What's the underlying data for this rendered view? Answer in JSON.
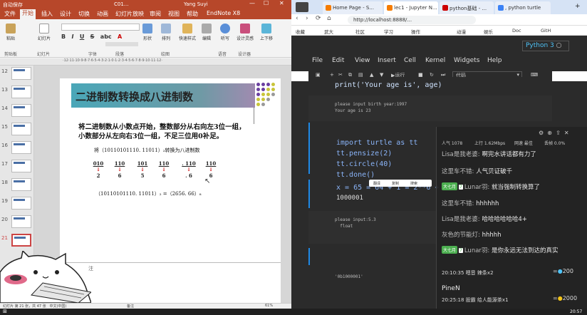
{
  "ppt": {
    "title_bar": {
      "quick": "自动保存",
      "doc": "C01...",
      "user": "Yang Suyi"
    },
    "tabs": [
      "文件",
      "开始",
      "插入",
      "设计",
      "切换",
      "动画",
      "幻灯片放映",
      "审阅",
      "视图",
      "帮助",
      "EndNote X8"
    ],
    "active_tab": "开始",
    "ribbon": {
      "buttons": [
        {
          "label": "粘贴"
        },
        {
          "label": "幻灯片"
        },
        {
          "label": "形状"
        },
        {
          "label": "排列"
        },
        {
          "label": "快速样式"
        },
        {
          "label": "编辑"
        },
        {
          "label": "听写"
        },
        {
          "label": "设计灵感"
        },
        {
          "label": "上下移"
        }
      ],
      "groups": [
        "剪贴板",
        "幻灯片",
        "字体",
        "段落",
        "绘图",
        "语音",
        "设计器"
      ],
      "font_row": [
        "B",
        "I",
        "U",
        "S",
        "abc",
        "A"
      ]
    },
    "ruler": "·12·11·10·9·8·7·6·5·4·3·2·1·0·1·2·3·4·5·6·7·8·9·10·11·12·",
    "thumb_numbers": [
      "12",
      "13",
      "14",
      "15",
      "16",
      "17",
      "18",
      "19",
      "20",
      "21"
    ],
    "slide": {
      "title": "二进制数转换成八进制数",
      "line1": "将二进制数从小数点开始，整数部分从右向左3位一组，",
      "line2": "小数部分从左向右3位一组，不足三位用0补足。",
      "example_caption": "将（10110101110. 11011）₂转换为八进制数",
      "groups": [
        {
          "bits": "010",
          "oct": "2"
        },
        {
          "bits": "110",
          "oct": "6"
        },
        {
          "bits": "101",
          "oct": "5"
        },
        {
          "bits": "110",
          "oct": "6"
        },
        {
          "bits": ". 110",
          "oct": ". 6"
        },
        {
          "bits": "110",
          "oct": "6"
        }
      ],
      "result": "（10110101110. 11011）₂ =（2656. 66）₈"
    },
    "notes": "注",
    "status": {
      "slide": "幻灯片 第 21 张，共 47 张",
      "lang": "中文(中国)",
      "notes": "备注",
      "zoom": "61%"
    }
  },
  "browser": {
    "tabs": [
      {
        "label": "Home Page - S..."
      },
      {
        "label": "lec1 - Jupyter N..."
      },
      {
        "label": "python基础 - ..."
      },
      {
        "label": ", python turtle"
      }
    ],
    "url": "http://localhost:8888/...",
    "bookmarks": [
      "收藏",
      "武大",
      "社区",
      "学习",
      "操作",
      "动漫",
      "娱乐",
      "Doc",
      "GitH"
    ]
  },
  "jupyter": {
    "menu": [
      "File",
      "Edit",
      "View",
      "Insert",
      "Cell",
      "Kernel",
      "Widgets",
      "Help"
    ],
    "kernel": "Python 3",
    "toolbar": {
      "run": "运行",
      "celltype": "代码"
    },
    "cell1_code": "print('Your age is', age)",
    "cell1_out": [
      "please input birth year:1997",
      "Your age is 23"
    ],
    "cell2_code": [
      "import turtle as tt",
      "tt.pensize(2)",
      "tt.circle(40)",
      "tt.done()"
    ],
    "cell3_code": "x = 65 = 64 + 1 = 2**6 + ...",
    "cell3_out": "1000001",
    "cell4_out": [
      "please input:5.3",
      "",
      "  float"
    ],
    "cell5_out": "'0b1000001'",
    "ctx_menu": [
      "翻译",
      "复制",
      "搜索"
    ]
  },
  "chat": {
    "stats": {
      "pop": "人气 1078",
      "up": "上行 1.62Mbps",
      "speed": "网速 最佳",
      "loss": "丢帧 0.0%"
    },
    "messages": [
      {
        "name": "Lisa是我老婆:",
        "text": "啊完水讲话都有力了"
      },
      {
        "name": "这里车不错:",
        "text": "人气贝证破千"
      },
      {
        "badge": "大七月",
        "lv": "7",
        "name": "Lunar羽:",
        "text": "就当强制转换算了"
      },
      {
        "name": "这里车不错:",
        "text": "hhhhhh"
      },
      {
        "name": "Lisa是我老婆:",
        "text": "哈哈哈哈哈哈4+"
      },
      {
        "name": "灰色的节能灯:",
        "text": "hhhhh"
      },
      {
        "badge": "大七月",
        "lv": "7",
        "name": "Lunar羽:",
        "text": "是你永远无法到达的真实"
      }
    ],
    "gifts": [
      {
        "time": "20:10:35",
        "who": "嗯音",
        "what": "辣条x2",
        "amount": "200"
      },
      {
        "user": "PineN"
      },
      {
        "time": "20:25:18",
        "who": "股霸",
        "what": "给人能源茶x1",
        "amount": "2000"
      }
    ]
  },
  "taskbar": {
    "time": "20:57"
  }
}
